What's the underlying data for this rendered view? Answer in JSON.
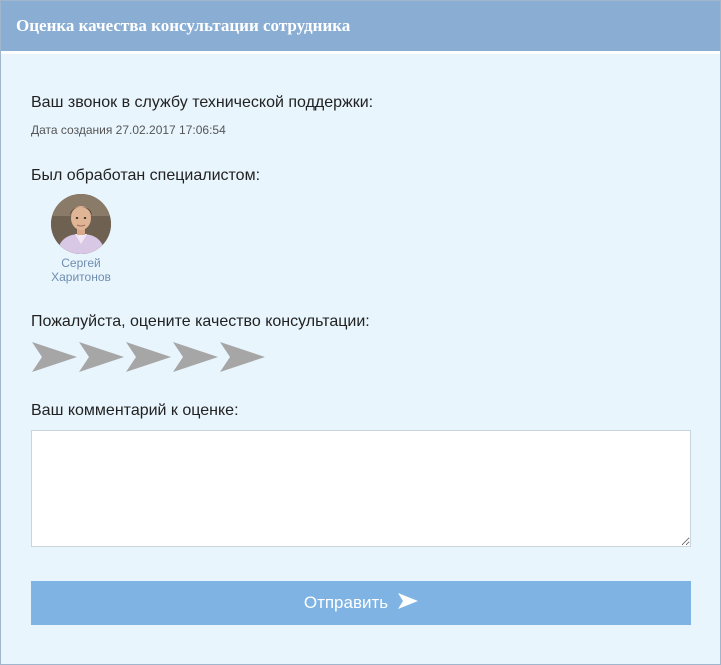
{
  "header": {
    "title": "Оценка качества консультации сотрудника"
  },
  "call": {
    "label": "Ваш звонок в службу технической поддержки:",
    "date_line": "Дата создания 27.02.2017 17:06:54"
  },
  "specialist": {
    "label": "Был обработан специалистом:",
    "first_name": "Сергей",
    "last_name": "Харитонов",
    "avatar_icon": "person-photo"
  },
  "rating": {
    "label": "Пожалуйста, оцените качество консультации:",
    "max": 5,
    "selected": 0,
    "icon": "arrow-icon",
    "inactive_color": "#a6a6a6"
  },
  "comment": {
    "label": "Ваш комментарий к оценке:",
    "value": "",
    "placeholder": ""
  },
  "submit": {
    "label": "Отправить",
    "color": "#7eb3e3"
  },
  "colors": {
    "header_bg": "#8aaed3",
    "body_bg": "#e8f5fd",
    "name_link": "#6f8db0"
  }
}
